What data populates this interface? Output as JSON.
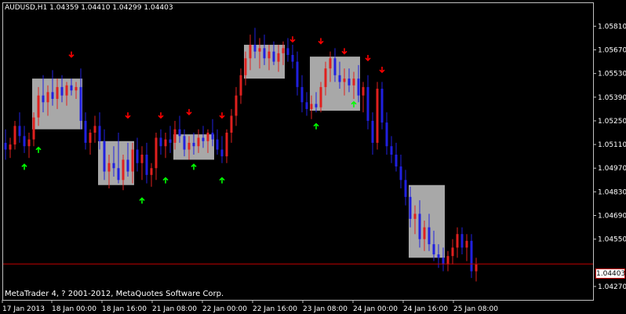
{
  "header": {
    "symbol_text": "AUDUSD,H1",
    "ohlc_text": "1.04359 1.04410 1.04299 1.04403"
  },
  "copyright": "MetaTrader 4, ? 2001-2012, MetaQuotes Software Corp.",
  "current_price": "1.04403",
  "colors": {
    "background": "#000000",
    "bull": "#e0201e",
    "bear": "#2020e0",
    "box": "#a8a8a8",
    "up_arrow": "#00ff00",
    "down_arrow": "#ff0000",
    "price_line": "#c00000"
  },
  "price_axis": [
    "1.05810",
    "1.05670",
    "1.05530",
    "1.05390",
    "1.05250",
    "1.05110",
    "1.04970",
    "1.04830",
    "1.04690",
    "1.04550",
    "1.04270"
  ],
  "time_axis": [
    "17 Jan 2013",
    "18 Jan 00:00",
    "18 Jan 16:00",
    "21 Jan 08:00",
    "22 Jan 00:00",
    "22 Jan 16:00",
    "23 Jan 08:00",
    "24 Jan 00:00",
    "24 Jan 16:00",
    "25 Jan 08:00"
  ],
  "chart_data": {
    "type": "candlestick",
    "price_range": [
      1.042,
      1.059
    ],
    "current": 1.04403,
    "candles": [
      {
        "t": 0,
        "o": 1.0512,
        "h": 1.052,
        "l": 1.0502,
        "c": 1.0508
      },
      {
        "t": 1,
        "o": 1.0508,
        "h": 1.0515,
        "l": 1.0503,
        "c": 1.0511
      },
      {
        "t": 2,
        "o": 1.0511,
        "h": 1.0525,
        "l": 1.0508,
        "c": 1.0522
      },
      {
        "t": 3,
        "o": 1.0522,
        "h": 1.053,
        "l": 1.0512,
        "c": 1.0516
      },
      {
        "t": 4,
        "o": 1.0516,
        "h": 1.0522,
        "l": 1.0506,
        "c": 1.051
      },
      {
        "t": 5,
        "o": 1.051,
        "h": 1.0518,
        "l": 1.0503,
        "c": 1.0514
      },
      {
        "t": 6,
        "o": 1.0514,
        "h": 1.053,
        "l": 1.051,
        "c": 1.0527
      },
      {
        "t": 7,
        "o": 1.0527,
        "h": 1.0545,
        "l": 1.0522,
        "c": 1.054
      },
      {
        "t": 8,
        "o": 1.054,
        "h": 1.0552,
        "l": 1.053,
        "c": 1.0536
      },
      {
        "t": 9,
        "o": 1.0536,
        "h": 1.0546,
        "l": 1.0528,
        "c": 1.0542
      },
      {
        "t": 10,
        "o": 1.0542,
        "h": 1.0555,
        "l": 1.0534,
        "c": 1.0538
      },
      {
        "t": 11,
        "o": 1.0538,
        "h": 1.055,
        "l": 1.0532,
        "c": 1.0545
      },
      {
        "t": 12,
        "o": 1.0545,
        "h": 1.0552,
        "l": 1.0536,
        "c": 1.054
      },
      {
        "t": 13,
        "o": 1.054,
        "h": 1.0548,
        "l": 1.0534,
        "c": 1.0546
      },
      {
        "t": 14,
        "o": 1.0546,
        "h": 1.055,
        "l": 1.054,
        "c": 1.0543
      },
      {
        "t": 15,
        "o": 1.0543,
        "h": 1.0548,
        "l": 1.0538,
        "c": 1.0545
      },
      {
        "t": 16,
        "o": 1.0545,
        "h": 1.0556,
        "l": 1.052,
        "c": 1.0525
      },
      {
        "t": 17,
        "o": 1.0525,
        "h": 1.053,
        "l": 1.0508,
        "c": 1.0512
      },
      {
        "t": 18,
        "o": 1.0512,
        "h": 1.052,
        "l": 1.0505,
        "c": 1.0518
      },
      {
        "t": 19,
        "o": 1.0518,
        "h": 1.0528,
        "l": 1.0512,
        "c": 1.0522
      },
      {
        "t": 20,
        "o": 1.0522,
        "h": 1.053,
        "l": 1.0508,
        "c": 1.0513
      },
      {
        "t": 21,
        "o": 1.0513,
        "h": 1.052,
        "l": 1.049,
        "c": 1.0495
      },
      {
        "t": 22,
        "o": 1.0495,
        "h": 1.0505,
        "l": 1.0485,
        "c": 1.05
      },
      {
        "t": 23,
        "o": 1.05,
        "h": 1.051,
        "l": 1.0492,
        "c": 1.0497
      },
      {
        "t": 24,
        "o": 1.0497,
        "h": 1.0518,
        "l": 1.0488,
        "c": 1.049
      },
      {
        "t": 25,
        "o": 1.049,
        "h": 1.0505,
        "l": 1.0484,
        "c": 1.0502
      },
      {
        "t": 26,
        "o": 1.0502,
        "h": 1.0512,
        "l": 1.0492,
        "c": 1.0495
      },
      {
        "t": 27,
        "o": 1.0495,
        "h": 1.0512,
        "l": 1.0488,
        "c": 1.0508
      },
      {
        "t": 28,
        "o": 1.0508,
        "h": 1.0515,
        "l": 1.0495,
        "c": 1.05
      },
      {
        "t": 29,
        "o": 1.05,
        "h": 1.051,
        "l": 1.049,
        "c": 1.0505
      },
      {
        "t": 30,
        "o": 1.0505,
        "h": 1.0512,
        "l": 1.0488,
        "c": 1.0493
      },
      {
        "t": 31,
        "o": 1.0493,
        "h": 1.05,
        "l": 1.0486,
        "c": 1.0497
      },
      {
        "t": 32,
        "o": 1.0497,
        "h": 1.0518,
        "l": 1.049,
        "c": 1.0515
      },
      {
        "t": 33,
        "o": 1.0515,
        "h": 1.052,
        "l": 1.0505,
        "c": 1.051
      },
      {
        "t": 34,
        "o": 1.051,
        "h": 1.0518,
        "l": 1.0503,
        "c": 1.0514
      },
      {
        "t": 35,
        "o": 1.0514,
        "h": 1.0522,
        "l": 1.0506,
        "c": 1.0512
      },
      {
        "t": 36,
        "o": 1.0512,
        "h": 1.0525,
        "l": 1.0508,
        "c": 1.052
      },
      {
        "t": 37,
        "o": 1.052,
        "h": 1.0528,
        "l": 1.0512,
        "c": 1.0516
      },
      {
        "t": 38,
        "o": 1.0516,
        "h": 1.052,
        "l": 1.0504,
        "c": 1.0508
      },
      {
        "t": 39,
        "o": 1.0508,
        "h": 1.0516,
        "l": 1.0502,
        "c": 1.0512
      },
      {
        "t": 40,
        "o": 1.0512,
        "h": 1.0518,
        "l": 1.0505,
        "c": 1.051
      },
      {
        "t": 41,
        "o": 1.051,
        "h": 1.052,
        "l": 1.0506,
        "c": 1.0515
      },
      {
        "t": 42,
        "o": 1.0515,
        "h": 1.0522,
        "l": 1.0509,
        "c": 1.0513
      },
      {
        "t": 43,
        "o": 1.0513,
        "h": 1.052,
        "l": 1.0506,
        "c": 1.0518
      },
      {
        "t": 44,
        "o": 1.0518,
        "h": 1.0526,
        "l": 1.051,
        "c": 1.0514
      },
      {
        "t": 45,
        "o": 1.0514,
        "h": 1.052,
        "l": 1.0505,
        "c": 1.0508
      },
      {
        "t": 46,
        "o": 1.0508,
        "h": 1.0516,
        "l": 1.05,
        "c": 1.0504
      },
      {
        "t": 47,
        "o": 1.0504,
        "h": 1.052,
        "l": 1.05,
        "c": 1.0518
      },
      {
        "t": 48,
        "o": 1.0518,
        "h": 1.0532,
        "l": 1.0512,
        "c": 1.0528
      },
      {
        "t": 49,
        "o": 1.0528,
        "h": 1.0545,
        "l": 1.0522,
        "c": 1.054
      },
      {
        "t": 50,
        "o": 1.054,
        "h": 1.0556,
        "l": 1.0535,
        "c": 1.0552
      },
      {
        "t": 51,
        "o": 1.0552,
        "h": 1.0566,
        "l": 1.0546,
        "c": 1.0562
      },
      {
        "t": 52,
        "o": 1.0562,
        "h": 1.0576,
        "l": 1.0555,
        "c": 1.057
      },
      {
        "t": 53,
        "o": 1.057,
        "h": 1.058,
        "l": 1.0562,
        "c": 1.0566
      },
      {
        "t": 54,
        "o": 1.0566,
        "h": 1.0574,
        "l": 1.0556,
        "c": 1.0568
      },
      {
        "t": 55,
        "o": 1.0568,
        "h": 1.0576,
        "l": 1.0558,
        "c": 1.0562
      },
      {
        "t": 56,
        "o": 1.0562,
        "h": 1.057,
        "l": 1.0555,
        "c": 1.0566
      },
      {
        "t": 57,
        "o": 1.0566,
        "h": 1.0572,
        "l": 1.0558,
        "c": 1.056
      },
      {
        "t": 58,
        "o": 1.056,
        "h": 1.057,
        "l": 1.0554,
        "c": 1.0565
      },
      {
        "t": 59,
        "o": 1.0565,
        "h": 1.0572,
        "l": 1.0558,
        "c": 1.0568
      },
      {
        "t": 60,
        "o": 1.0568,
        "h": 1.0574,
        "l": 1.056,
        "c": 1.0564
      },
      {
        "t": 61,
        "o": 1.0564,
        "h": 1.057,
        "l": 1.0556,
        "c": 1.056
      },
      {
        "t": 62,
        "o": 1.056,
        "h": 1.0566,
        "l": 1.054,
        "c": 1.0545
      },
      {
        "t": 63,
        "o": 1.0545,
        "h": 1.0552,
        "l": 1.053,
        "c": 1.0536
      },
      {
        "t": 64,
        "o": 1.0536,
        "h": 1.0542,
        "l": 1.0528,
        "c": 1.0532
      },
      {
        "t": 65,
        "o": 1.0532,
        "h": 1.054,
        "l": 1.0526,
        "c": 1.0535
      },
      {
        "t": 66,
        "o": 1.0535,
        "h": 1.0542,
        "l": 1.053,
        "c": 1.0533
      },
      {
        "t": 67,
        "o": 1.0533,
        "h": 1.0548,
        "l": 1.053,
        "c": 1.0545
      },
      {
        "t": 68,
        "o": 1.0545,
        "h": 1.056,
        "l": 1.054,
        "c": 1.0556
      },
      {
        "t": 69,
        "o": 1.0556,
        "h": 1.0566,
        "l": 1.0548,
        "c": 1.0562
      },
      {
        "t": 70,
        "o": 1.0562,
        "h": 1.0568,
        "l": 1.0548,
        "c": 1.0552
      },
      {
        "t": 71,
        "o": 1.0552,
        "h": 1.056,
        "l": 1.0544,
        "c": 1.0548
      },
      {
        "t": 72,
        "o": 1.0548,
        "h": 1.0556,
        "l": 1.054,
        "c": 1.055
      },
      {
        "t": 73,
        "o": 1.055,
        "h": 1.0556,
        "l": 1.0542,
        "c": 1.0546
      },
      {
        "t": 74,
        "o": 1.0546,
        "h": 1.0554,
        "l": 1.0538,
        "c": 1.055
      },
      {
        "t": 75,
        "o": 1.055,
        "h": 1.0558,
        "l": 1.0536,
        "c": 1.054
      },
      {
        "t": 76,
        "o": 1.054,
        "h": 1.0548,
        "l": 1.053,
        "c": 1.0545
      },
      {
        "t": 77,
        "o": 1.0545,
        "h": 1.0552,
        "l": 1.052,
        "c": 1.0525
      },
      {
        "t": 78,
        "o": 1.0525,
        "h": 1.053,
        "l": 1.0505,
        "c": 1.0512
      },
      {
        "t": 79,
        "o": 1.0512,
        "h": 1.0548,
        "l": 1.0508,
        "c": 1.0544
      },
      {
        "t": 80,
        "o": 1.0544,
        "h": 1.0548,
        "l": 1.052,
        "c": 1.0524
      },
      {
        "t": 81,
        "o": 1.0524,
        "h": 1.053,
        "l": 1.0505,
        "c": 1.051
      },
      {
        "t": 82,
        "o": 1.051,
        "h": 1.0516,
        "l": 1.05,
        "c": 1.0505
      },
      {
        "t": 83,
        "o": 1.0505,
        "h": 1.0512,
        "l": 1.0495,
        "c": 1.0498
      },
      {
        "t": 84,
        "o": 1.0498,
        "h": 1.0505,
        "l": 1.0485,
        "c": 1.049
      },
      {
        "t": 85,
        "o": 1.049,
        "h": 1.0496,
        "l": 1.0475,
        "c": 1.048
      },
      {
        "t": 86,
        "o": 1.048,
        "h": 1.0486,
        "l": 1.0462,
        "c": 1.0467
      },
      {
        "t": 87,
        "o": 1.0467,
        "h": 1.0475,
        "l": 1.0458,
        "c": 1.047
      },
      {
        "t": 88,
        "o": 1.047,
        "h": 1.0478,
        "l": 1.045,
        "c": 1.0455
      },
      {
        "t": 89,
        "o": 1.0455,
        "h": 1.0466,
        "l": 1.0448,
        "c": 1.0462
      },
      {
        "t": 90,
        "o": 1.0462,
        "h": 1.047,
        "l": 1.0448,
        "c": 1.0452
      },
      {
        "t": 91,
        "o": 1.0452,
        "h": 1.046,
        "l": 1.0442,
        "c": 1.0446
      },
      {
        "t": 92,
        "o": 1.0446,
        "h": 1.0452,
        "l": 1.0438,
        "c": 1.0444
      },
      {
        "t": 93,
        "o": 1.0444,
        "h": 1.045,
        "l": 1.0436,
        "c": 1.044
      },
      {
        "t": 94,
        "o": 1.044,
        "h": 1.0448,
        "l": 1.0436,
        "c": 1.0445
      },
      {
        "t": 95,
        "o": 1.0445,
        "h": 1.0455,
        "l": 1.044,
        "c": 1.045
      },
      {
        "t": 96,
        "o": 1.045,
        "h": 1.0462,
        "l": 1.0444,
        "c": 1.0458
      },
      {
        "t": 97,
        "o": 1.0458,
        "h": 1.0462,
        "l": 1.0446,
        "c": 1.045
      },
      {
        "t": 98,
        "o": 1.045,
        "h": 1.0458,
        "l": 1.0442,
        "c": 1.0454
      },
      {
        "t": 99,
        "o": 1.0454,
        "h": 1.0458,
        "l": 1.0432,
        "c": 1.0436
      },
      {
        "t": 100,
        "o": 1.0436,
        "h": 1.0444,
        "l": 1.043,
        "c": 1.044
      }
    ],
    "boxes": [
      {
        "t0": 6,
        "t1": 16,
        "hi": 1.055,
        "lo": 1.052
      },
      {
        "t0": 20,
        "t1": 27,
        "hi": 1.0513,
        "lo": 1.0487
      },
      {
        "t0": 36,
        "t1": 44,
        "hi": 1.0517,
        "lo": 1.0502
      },
      {
        "t0": 51,
        "t1": 59,
        "hi": 1.057,
        "lo": 1.055
      },
      {
        "t0": 65,
        "t1": 75,
        "hi": 1.0563,
        "lo": 1.0531
      },
      {
        "t0": 86,
        "t1": 93,
        "hi": 1.0487,
        "lo": 1.0444
      }
    ],
    "down_arrows": [
      {
        "t": 14,
        "p": 1.0566
      },
      {
        "t": 26,
        "p": 1.053
      },
      {
        "t": 33,
        "p": 1.053
      },
      {
        "t": 39,
        "p": 1.0532
      },
      {
        "t": 46,
        "p": 1.053
      },
      {
        "t": 61,
        "p": 1.0575
      },
      {
        "t": 67,
        "p": 1.0574
      },
      {
        "t": 72,
        "p": 1.0568
      },
      {
        "t": 77,
        "p": 1.0564
      },
      {
        "t": 80,
        "p": 1.0557
      }
    ],
    "up_arrows": [
      {
        "t": 4,
        "p": 1.0496
      },
      {
        "t": 7,
        "p": 1.0506
      },
      {
        "t": 29,
        "p": 1.0476
      },
      {
        "t": 34,
        "p": 1.0488
      },
      {
        "t": 40,
        "p": 1.0496
      },
      {
        "t": 46,
        "p": 1.0488
      },
      {
        "t": 66,
        "p": 1.052
      },
      {
        "t": 74,
        "p": 1.0533
      }
    ]
  }
}
